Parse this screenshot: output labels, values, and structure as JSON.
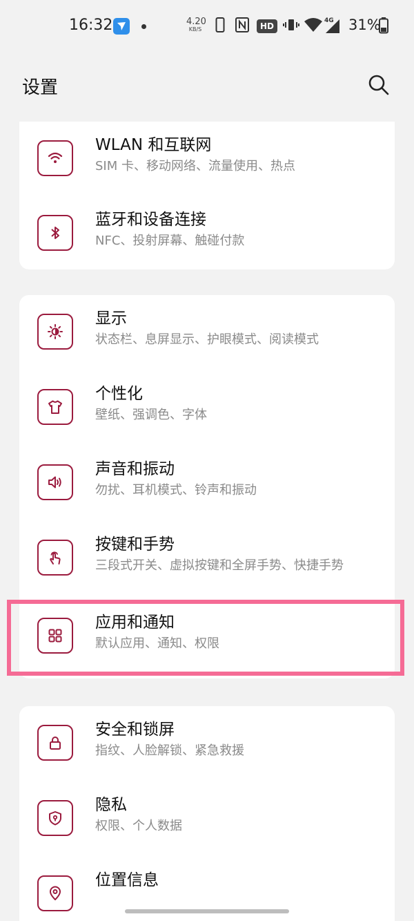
{
  "status_bar": {
    "time": "16:32",
    "net_speed_value": "4.20",
    "net_speed_unit": "KB/S",
    "hd_badge": "HD",
    "network_type": "4G",
    "battery_percent": "31%",
    "icons": [
      "app-notification-icon",
      "dot-icon",
      "phone-icon",
      "nfc-icon",
      "vibrate-icon",
      "wifi-icon",
      "signal-icon",
      "battery-icon"
    ]
  },
  "header": {
    "title": "设置",
    "search_icon": "search-icon"
  },
  "groups": [
    {
      "items": [
        {
          "title": "WLAN 和互联网",
          "subtitle": "SIM 卡、移动网络、流量使用、热点",
          "icon": "wifi-icon"
        },
        {
          "title": "蓝牙和设备连接",
          "subtitle": "NFC、投射屏幕、触碰付款",
          "icon": "bluetooth-icon"
        }
      ]
    },
    {
      "items": [
        {
          "title": "显示",
          "subtitle": "状态栏、息屏显示、护眼模式、阅读模式",
          "icon": "brightness-icon"
        },
        {
          "title": "个性化",
          "subtitle": "壁纸、强调色、字体",
          "icon": "tshirt-icon"
        },
        {
          "title": "声音和振动",
          "subtitle": "勿扰、耳机模式、铃声和振动",
          "icon": "speaker-icon"
        },
        {
          "title": "按键和手势",
          "subtitle": "三段式开关、虚拟按键和全屏手势、快捷手势",
          "icon": "gesture-icon"
        },
        {
          "title": "应用和通知",
          "subtitle": "默认应用、通知、权限",
          "icon": "apps-grid-icon",
          "highlighted": true
        }
      ]
    },
    {
      "items": [
        {
          "title": "安全和锁屏",
          "subtitle": "指纹、人脸解锁、紧急救援",
          "icon": "lock-icon"
        },
        {
          "title": "隐私",
          "subtitle": "权限、个人数据",
          "icon": "privacy-shield-icon"
        },
        {
          "title": "位置信息",
          "subtitle": "",
          "icon": "location-pin-icon"
        }
      ]
    }
  ],
  "colors": {
    "accent": "#9b1b3e",
    "highlight_border": "#f56b95",
    "background": "#f2f2f2",
    "card": "#ffffff",
    "subtitle": "#8a8a8a"
  }
}
